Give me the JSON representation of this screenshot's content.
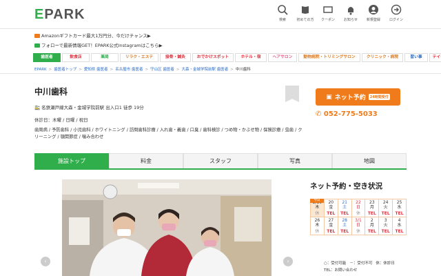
{
  "header": {
    "logo_e": "E",
    "logo_rest": "PARK",
    "icons": [
      {
        "name": "search-icon",
        "label": "検索"
      },
      {
        "name": "book-icon",
        "label": "初めての方"
      },
      {
        "name": "coupon-icon",
        "label": "クーポン"
      },
      {
        "name": "bell-icon",
        "label": "お知らせ"
      },
      {
        "name": "user-icon",
        "label": "新規登録"
      },
      {
        "name": "login-icon",
        "label": "ログイン"
      }
    ]
  },
  "promos": [
    "Amazonギフトカード最大1万円分、今だけチャンス▶",
    "フォローで最新情報GET！EPARK公式Instagramはこちら▶"
  ],
  "colors": {
    "green": "#2fae4b",
    "orange": "#f07b1a",
    "link": "#2b6cc9"
  },
  "categories": [
    {
      "label": "歯医者",
      "color": "#2fae4b",
      "active": true
    },
    {
      "label": "飲食店",
      "color": "#e0303c"
    },
    {
      "label": "薬局",
      "color": "#2fae4b"
    },
    {
      "label": "リラク・エステ",
      "color": "#e07a1a"
    },
    {
      "label": "接骨・鍼灸",
      "color": "#e0303c"
    },
    {
      "label": "おでかけスポット",
      "color": "#e0303c"
    },
    {
      "label": "ホテル・宿",
      "color": "#e0303c"
    },
    {
      "label": "ヘアサロン",
      "color": "#e05c8a"
    },
    {
      "label": "動物病院・トリミングサロン",
      "color": "#e07a1a"
    },
    {
      "label": "クリニック・病院",
      "color": "#e07a1a"
    },
    {
      "label": "習い事",
      "color": "#2b6cc9"
    },
    {
      "label": "テイクアウト",
      "color": "#e0303c"
    }
  ],
  "breadcrumb": [
    "EPARK",
    "歯医者トップ",
    "愛知県 歯医者",
    "名古屋市 歯医者",
    "守山区 歯医者",
    "大森・金城学院前駅 歯医者",
    "中川歯科"
  ],
  "clinic": {
    "name": "中川歯科",
    "station": "名鉄瀬戸線大森・金城学院前駅 出入口1 徒歩 19分",
    "closed": "休診日：木曜 / 日曜 / 祝日",
    "treatments": "歯周病 / 予防歯科 / 小児歯科 / ホワイトニング / 訪問歯科診療 / 入れ歯・義歯 / 口臭 / 歯科検診 / つめ物・かぶせ物 / 保険診療 / 虫歯 / クリーニング / 顎関節症 / 噛み合わせ"
  },
  "reserve": {
    "label": "ネット予約",
    "badge": "24時間受付",
    "tel": "052-775-5033"
  },
  "tabs": [
    "施設トップ",
    "料金",
    "スタッフ",
    "写真",
    "地図"
  ],
  "availability": {
    "heading": "ネット予約・空き状況",
    "today_label": "今日",
    "weeks": [
      [
        {
          "d": "2/19",
          "w": "木",
          "s": "休",
          "t": "n"
        },
        {
          "d": "20",
          "w": "金",
          "s": "TEL",
          "t": "n"
        },
        {
          "d": "21",
          "w": "土",
          "s": "TEL",
          "t": "sat"
        },
        {
          "d": "22",
          "w": "日",
          "s": "休",
          "t": "sun"
        },
        {
          "d": "23",
          "w": "月",
          "s": "TEL",
          "t": "n"
        },
        {
          "d": "24",
          "w": "火",
          "s": "TEL",
          "t": "n"
        },
        {
          "d": "25",
          "w": "水",
          "s": "TEL",
          "t": "n"
        }
      ],
      [
        {
          "d": "26",
          "w": "木",
          "s": "休",
          "t": "n"
        },
        {
          "d": "27",
          "w": "金",
          "s": "TEL",
          "t": "n"
        },
        {
          "d": "28",
          "w": "土",
          "s": "TEL",
          "t": "sat"
        },
        {
          "d": "3/1",
          "w": "日",
          "s": "休",
          "t": "sun"
        },
        {
          "d": "2",
          "w": "月",
          "s": "TEL",
          "t": "n"
        },
        {
          "d": "3",
          "w": "火",
          "s": "TEL",
          "t": "n"
        },
        {
          "d": "4",
          "w": "水",
          "s": "TEL",
          "t": "n"
        }
      ]
    ],
    "legend": [
      "○：受付可能",
      "－：受付不可",
      "休：休診日",
      "TEL：お問い合わせ"
    ]
  }
}
